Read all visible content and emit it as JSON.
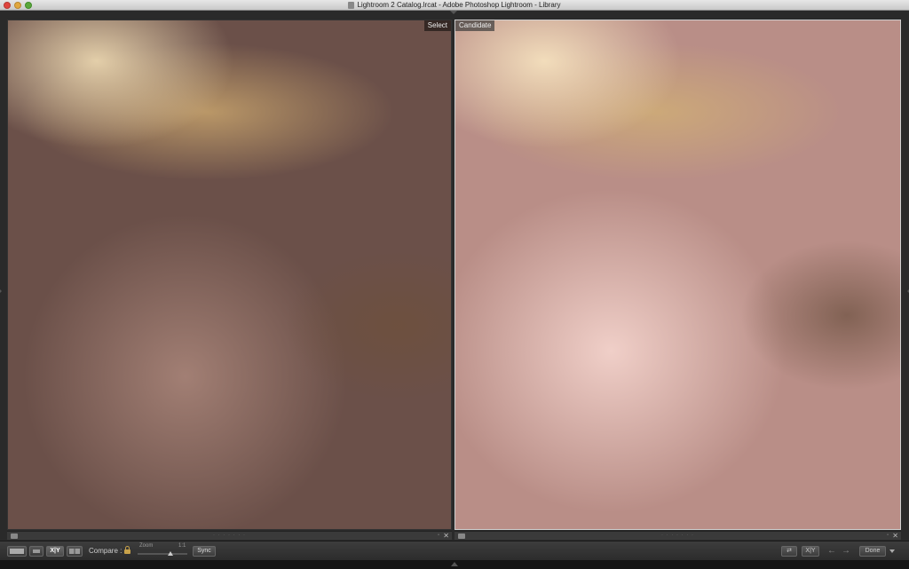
{
  "window": {
    "title": "Lightroom 2 Catalog.lrcat - Adobe Photoshop Lightroom - Library"
  },
  "panes": {
    "select_label": "Select",
    "candidate_label": "Candidate",
    "bar_dots": "· · · · · · ·",
    "close_glyph": "✕"
  },
  "toolbar": {
    "compare_label": "Compare :",
    "zoom_label": "Zoom",
    "zoom_ratio": "1:1",
    "sync_label": "Sync",
    "xy_label": "X|Y",
    "swap_xy_label": "X|Y",
    "done_label": "Done",
    "prev_arrow": "←",
    "next_arrow": "→"
  }
}
